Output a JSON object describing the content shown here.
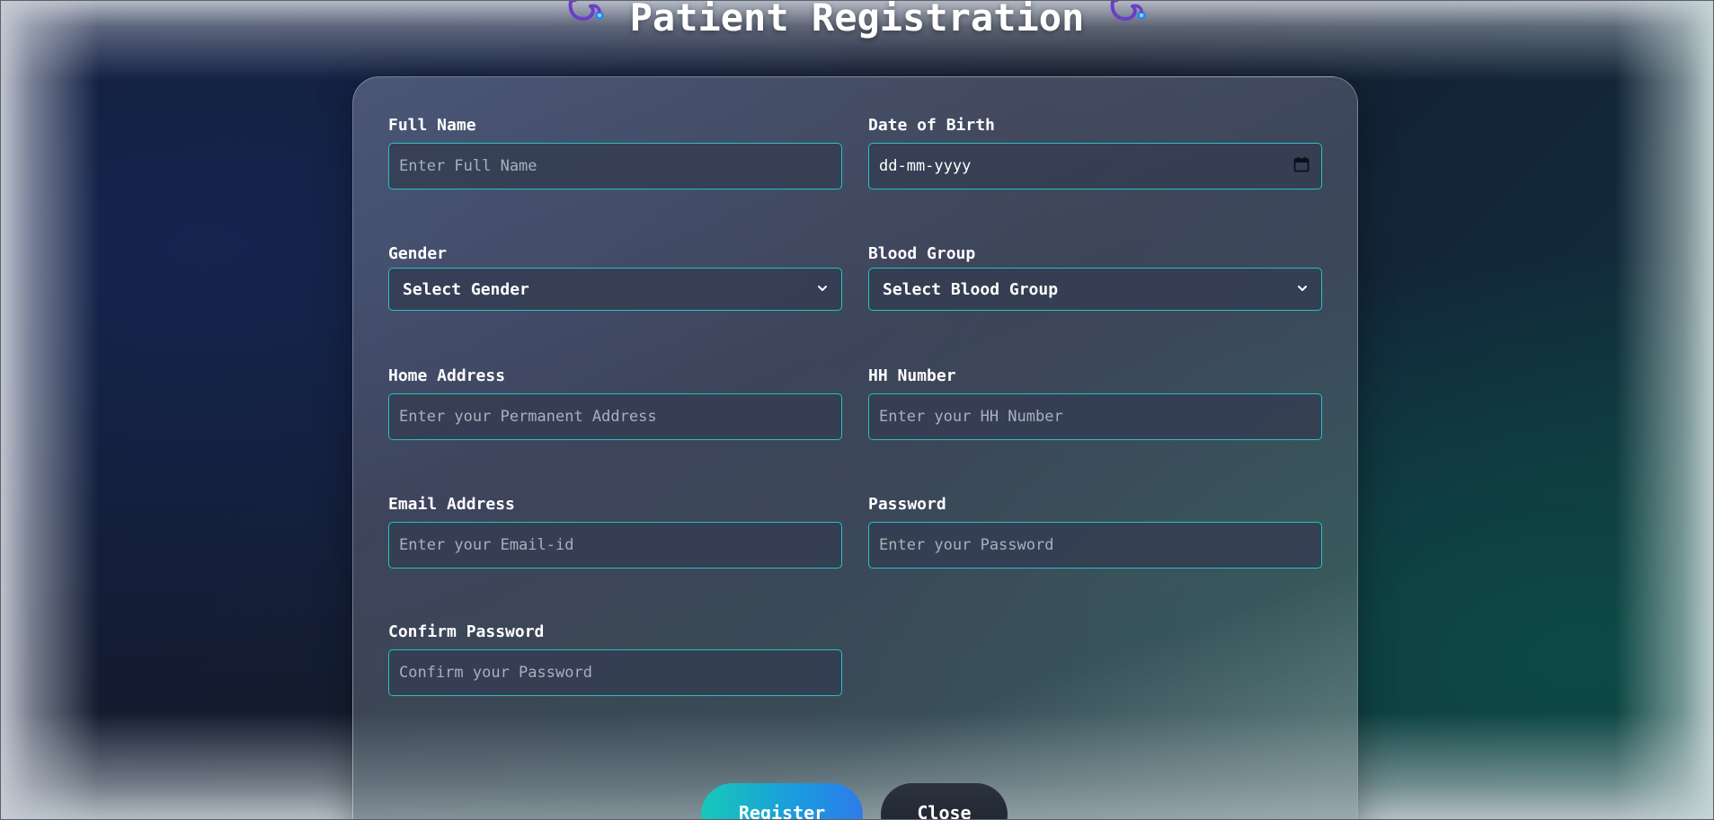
{
  "page": {
    "title": "Patient Registration"
  },
  "form": {
    "full_name": {
      "label": "Full Name",
      "placeholder": "Enter Full Name",
      "value": ""
    },
    "dob": {
      "label": "Date of Birth",
      "value": "dd-mm-yyyy"
    },
    "gender": {
      "label": "Gender",
      "selected": "Select Gender"
    },
    "blood_group": {
      "label": "Blood Group",
      "selected": "Select Blood Group"
    },
    "home_address": {
      "label": "Home Address",
      "placeholder": "Enter your Permanent Address",
      "value": ""
    },
    "hh_number": {
      "label": "HH Number",
      "placeholder": "Enter your HH Number",
      "value": ""
    },
    "email": {
      "label": "Email Address",
      "placeholder": "Enter your Email-id",
      "value": ""
    },
    "password": {
      "label": "Password",
      "placeholder": "Enter your Password",
      "value": ""
    },
    "confirm_password": {
      "label": "Confirm Password",
      "placeholder": "Confirm your Password",
      "value": ""
    }
  },
  "buttons": {
    "register_label": "Register",
    "close_label": "Close"
  },
  "icons": {
    "title_left": "stethoscope-icon",
    "title_right": "stethoscope-icon",
    "dob_picker": "calendar-icon",
    "select_arrow": "chevron-down-icon"
  },
  "colors": {
    "input_border": "#22c3c3",
    "input_background": "#343e52",
    "stethoscope": "#6a3fc8",
    "stethoscope_tip": "#2f86e8",
    "register_gradient_start": "#18c8b8",
    "register_gradient_end": "#2f7bea",
    "close_background": "#1f2530"
  }
}
